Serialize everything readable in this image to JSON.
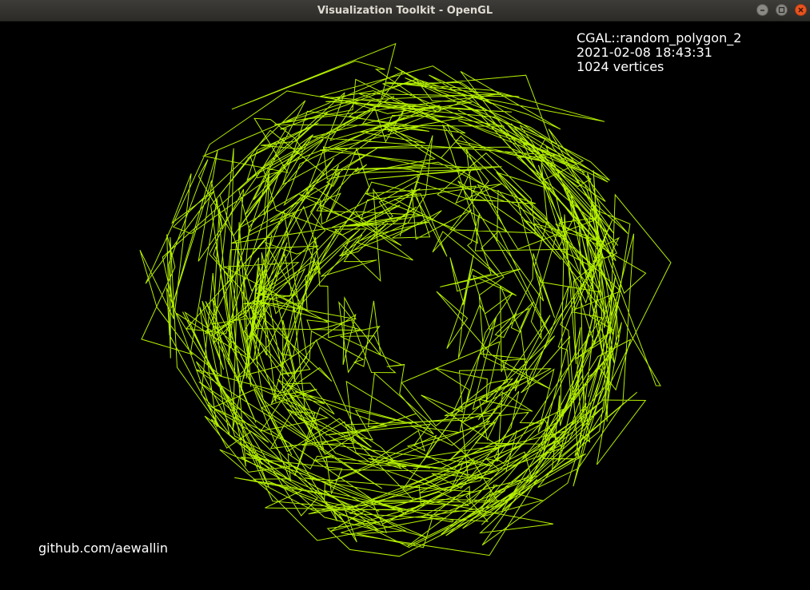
{
  "window": {
    "title": "Visualization Toolkit - OpenGL",
    "controls": [
      "minimize-icon",
      "maximize-icon",
      "close-icon"
    ]
  },
  "overlay": {
    "line1": "CGAL::random_polygon_2",
    "line2": "2021-02-08 18:43:31",
    "line3": "1024 vertices"
  },
  "credit": "github.com/aewallin",
  "colors": {
    "polygon_stroke": "#b4f000",
    "background": "#000000",
    "text": "#ffffff"
  }
}
